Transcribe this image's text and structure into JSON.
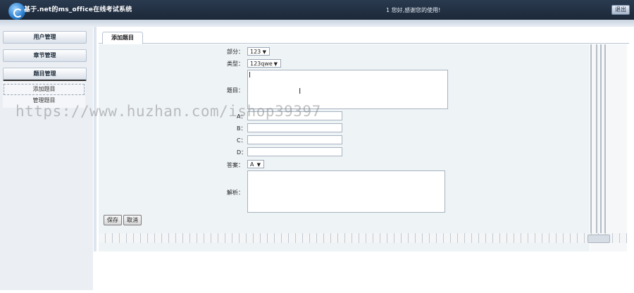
{
  "header": {
    "app_title": "基于.net的ms_office在线考试系统",
    "welcome": "1 您好,感谢您的使用!",
    "logout": "退出"
  },
  "sidebar": {
    "groups": [
      {
        "label": "用户管理"
      },
      {
        "label": "章节管理"
      },
      {
        "label": "题目管理"
      }
    ],
    "subitems": [
      {
        "label": "添加题目"
      },
      {
        "label": "管理题目"
      }
    ]
  },
  "tab": {
    "label": "添加题目"
  },
  "form": {
    "part_label": "部分：",
    "part_value": "123",
    "type_label": "类型：",
    "type_value": "123qwe",
    "question_label": "题目：",
    "a_label": "A：",
    "b_label": "B：",
    "c_label": "C：",
    "d_label": "D：",
    "answer_label": "答案：",
    "answer_value": "A",
    "analysis_label": "解析："
  },
  "buttons": {
    "save": "保存",
    "cancel": "取消"
  },
  "watermark": "https://www.huzhan.com/ishop39397"
}
